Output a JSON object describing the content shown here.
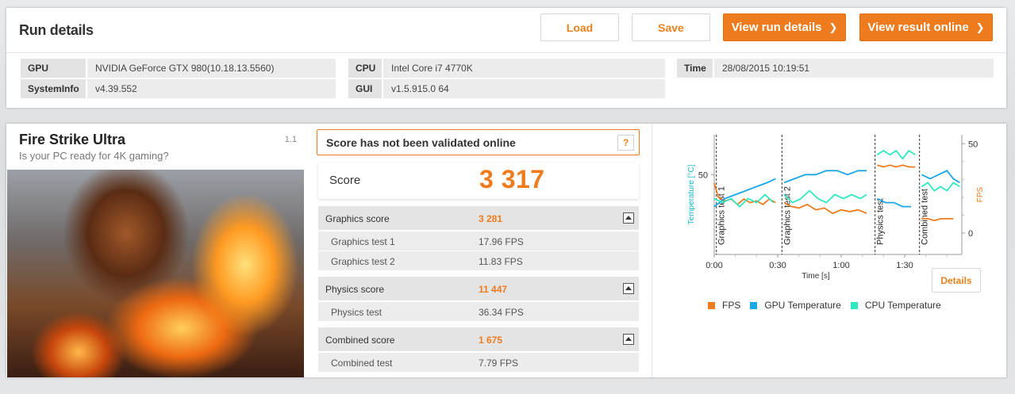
{
  "header": {
    "title": "Run details",
    "buttons": {
      "load": "Load",
      "save": "Save",
      "view_run_details": "View run details",
      "view_result_online": "View result online",
      "chevron": "❯"
    }
  },
  "system_info": {
    "gpu_label": "GPU",
    "gpu_value": "NVIDIA GeForce GTX 980(10.18.13.5560)",
    "systeminfo_label": "SystemInfo",
    "systeminfo_value": "v4.39.552",
    "cpu_label": "CPU",
    "cpu_value": "Intel Core i7 4770K",
    "gui_label": "GUI",
    "gui_value": "v1.5.915.0 64",
    "time_label": "Time",
    "time_value": "28/08/2015 10:19:51"
  },
  "benchmark": {
    "title": "Fire Strike Ultra",
    "subtitle": "Is your PC ready for 4K gaming?",
    "version": "1.1"
  },
  "validation": {
    "text": "Score has not been validated online",
    "help": "?"
  },
  "score": {
    "label": "Score",
    "value": "3 317"
  },
  "sections": {
    "graphics": {
      "label": "Graphics score",
      "value": "3 281",
      "tests": [
        {
          "label": "Graphics test 1",
          "value": "17.96 FPS"
        },
        {
          "label": "Graphics test 2",
          "value": "11.83 FPS"
        }
      ]
    },
    "physics": {
      "label": "Physics score",
      "value": "11 447",
      "tests": [
        {
          "label": "Physics test",
          "value": "36.34 FPS"
        }
      ]
    },
    "combined": {
      "label": "Combined score",
      "value": "1 675",
      "tests": [
        {
          "label": "Combined test",
          "value": "7.79 FPS"
        }
      ]
    }
  },
  "chart": {
    "details_button": "Details",
    "chart_data": {
      "type": "line",
      "xlabel": "Time [s]",
      "ylabel_left": "Temperature [°C]",
      "ylabel_right": "FPS",
      "x_ticks": [
        "0:00",
        "0:30",
        "1:00",
        "1:30"
      ],
      "x_tick_values": [
        0,
        30,
        60,
        90
      ],
      "xlim": [
        0,
        117
      ],
      "left_ticks": [
        "50"
      ],
      "left_tick_values": [
        50
      ],
      "right_ticks": [
        "50",
        "0"
      ],
      "right_tick_values": [
        50,
        0
      ],
      "temp_ylim": [
        30,
        60
      ],
      "fps_ylim": [
        -12,
        55
      ],
      "phases": [
        {
          "label": "Graphics test 1",
          "x": 1
        },
        {
          "label": "Graphics test 2",
          "x": 32
        },
        {
          "label": "Physics test",
          "x": 76
        },
        {
          "label": "Combined test",
          "x": 97
        }
      ],
      "legend": [
        "FPS",
        "GPU Temperature",
        "CPU Temperature"
      ],
      "colors": {
        "fps": "#ee7b1d",
        "gpu": "#1aa7e6",
        "cpu": "#2ee8c0",
        "left_axis": "#16b8c8",
        "right_axis": "#ee7b1d"
      },
      "series": [
        {
          "name": "FPS",
          "axis": "right",
          "segments": [
            [
              [
                0,
                28
              ],
              [
                2,
                20
              ],
              [
                5,
                18
              ],
              [
                8,
                19
              ],
              [
                11,
                16
              ],
              [
                14,
                19
              ],
              [
                17,
                17
              ],
              [
                20,
                18
              ],
              [
                23,
                16
              ],
              [
                26,
                19
              ],
              [
                29,
                17
              ]
            ],
            [
              [
                33,
                17
              ],
              [
                36,
                15
              ],
              [
                40,
                14
              ],
              [
                44,
                16
              ],
              [
                48,
                13
              ],
              [
                52,
                14
              ],
              [
                56,
                11
              ],
              [
                60,
                13
              ],
              [
                64,
                12
              ],
              [
                68,
                13
              ],
              [
                72,
                11
              ]
            ],
            [
              [
                77,
                38
              ],
              [
                80,
                37
              ],
              [
                83,
                38
              ],
              [
                86,
                37
              ],
              [
                89,
                38
              ],
              [
                92,
                37
              ],
              [
                95,
                37
              ]
            ],
            [
              [
                98,
                8
              ],
              [
                101,
                8
              ],
              [
                104,
                7
              ],
              [
                107,
                8
              ],
              [
                110,
                8
              ],
              [
                113,
                8
              ]
            ]
          ]
        },
        {
          "name": "GPU Temperature",
          "axis": "left",
          "segments": [
            [
              [
                0,
                42
              ],
              [
                5,
                44
              ],
              [
                10,
                45
              ],
              [
                15,
                46
              ],
              [
                20,
                47
              ],
              [
                25,
                48
              ],
              [
                29,
                49
              ]
            ],
            [
              [
                33,
                48
              ],
              [
                38,
                49
              ],
              [
                43,
                50
              ],
              [
                48,
                50
              ],
              [
                53,
                51
              ],
              [
                58,
                51
              ],
              [
                63,
                50
              ],
              [
                68,
                51
              ],
              [
                72,
                51
              ]
            ],
            [
              [
                77,
                44
              ],
              [
                81,
                43
              ],
              [
                85,
                43
              ],
              [
                89,
                42
              ],
              [
                93,
                42
              ]
            ],
            [
              [
                98,
                50
              ],
              [
                102,
                49
              ],
              [
                106,
                50
              ],
              [
                110,
                51
              ],
              [
                113,
                49
              ],
              [
                116,
                48
              ]
            ]
          ]
        },
        {
          "name": "CPU Temperature",
          "axis": "left",
          "segments": [
            [
              [
                0,
                44
              ],
              [
                4,
                43
              ],
              [
                8,
                44
              ],
              [
                12,
                42
              ],
              [
                16,
                44
              ],
              [
                20,
                43
              ],
              [
                24,
                45
              ],
              [
                28,
                43
              ]
            ],
            [
              [
                33,
                45
              ],
              [
                37,
                43
              ],
              [
                41,
                44
              ],
              [
                45,
                46
              ],
              [
                49,
                44
              ],
              [
                53,
                43
              ],
              [
                57,
                45
              ],
              [
                61,
                44
              ],
              [
                65,
                45
              ],
              [
                69,
                44
              ],
              [
                72,
                45
              ]
            ],
            [
              [
                77,
                55
              ],
              [
                80,
                56
              ],
              [
                83,
                55
              ],
              [
                86,
                56
              ],
              [
                89,
                54
              ],
              [
                92,
                56
              ],
              [
                95,
                55
              ]
            ],
            [
              [
                98,
                47
              ],
              [
                101,
                48
              ],
              [
                104,
                46
              ],
              [
                107,
                47
              ],
              [
                110,
                46
              ],
              [
                113,
                48
              ],
              [
                116,
                47
              ]
            ]
          ]
        }
      ]
    }
  }
}
